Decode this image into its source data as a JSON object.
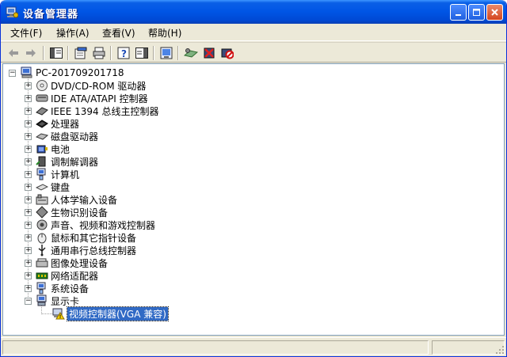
{
  "window": {
    "title": "设备管理器",
    "controls": {
      "minimize": "minimize",
      "maximize": "maximize",
      "close": "close"
    }
  },
  "menu": [
    {
      "label": "文件(F)"
    },
    {
      "label": "操作(A)"
    },
    {
      "label": "查看(V)"
    },
    {
      "label": "帮助(H)"
    }
  ],
  "toolbar": {
    "icons": [
      "back-arrow-icon",
      "forward-arrow-icon",
      "console-tree-icon",
      "properties-icon",
      "print-icon",
      "help-icon",
      "show-hide-icon",
      "refresh-icon",
      "scan-hardware-icon",
      "uninstall-icon",
      "disable-icon"
    ]
  },
  "tree": {
    "root": "PC-201709201718",
    "categories": [
      {
        "label": "DVD/CD-ROM 驱动器",
        "icon": "cdrom-icon"
      },
      {
        "label": "IDE ATA/ATAPI 控制器",
        "icon": "ide-icon"
      },
      {
        "label": "IEEE 1394 总线主控制器",
        "icon": "ieee1394-icon"
      },
      {
        "label": "处理器",
        "icon": "processor-icon"
      },
      {
        "label": "磁盘驱动器",
        "icon": "disk-icon"
      },
      {
        "label": "电池",
        "icon": "battery-icon"
      },
      {
        "label": "调制解调器",
        "icon": "modem-icon"
      },
      {
        "label": "计算机",
        "icon": "computer-icon"
      },
      {
        "label": "键盘",
        "icon": "keyboard-icon"
      },
      {
        "label": "人体学输入设备",
        "icon": "hid-icon"
      },
      {
        "label": "生物识别设备",
        "icon": "biometric-icon"
      },
      {
        "label": "声音、视频和游戏控制器",
        "icon": "sound-icon"
      },
      {
        "label": "鼠标和其它指针设备",
        "icon": "mouse-icon"
      },
      {
        "label": "通用串行总线控制器",
        "icon": "usb-icon"
      },
      {
        "label": "图像处理设备",
        "icon": "imaging-icon"
      },
      {
        "label": "网络适配器",
        "icon": "network-icon"
      },
      {
        "label": "系统设备",
        "icon": "system-icon"
      },
      {
        "label": "显示卡",
        "icon": "display-icon"
      }
    ],
    "child": {
      "label": "视频控制器(VGA 兼容)",
      "icon": "warning-device-icon"
    }
  },
  "watermark": "",
  "colors": {
    "titlebar": "#0055e5",
    "selection": "#316ac5",
    "window_bg": "#ece9d8"
  }
}
